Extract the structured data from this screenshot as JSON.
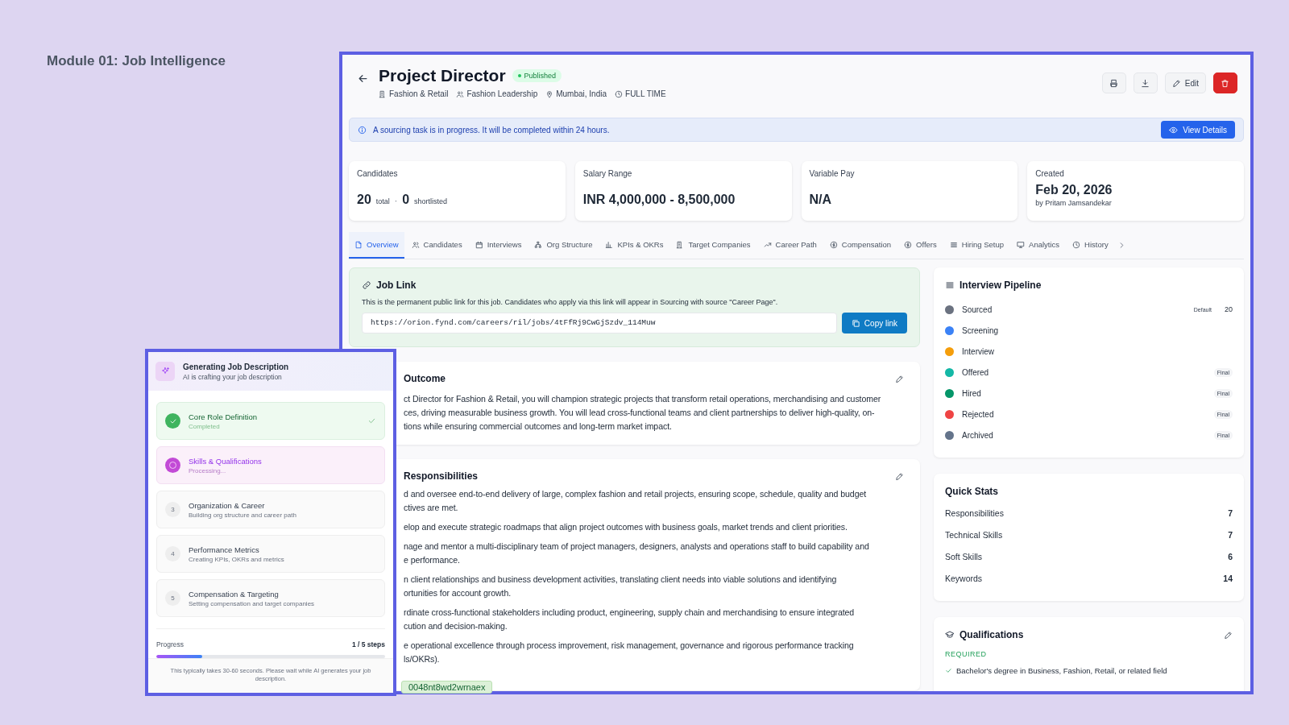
{
  "page_title": "Module 01: Job Intelligence",
  "job": {
    "title": "Project Director",
    "status": "Published",
    "meta": [
      "Fashion & Retail",
      "Fashion Leadership",
      "Mumbai, India",
      "FULL TIME"
    ],
    "edit_button": "Edit"
  },
  "banner": {
    "message": "A sourcing task is in progress. It will be completed within 24 hours.",
    "button": "View Details"
  },
  "stats": [
    {
      "label": "Candidates",
      "kind": "candidates",
      "total": "20",
      "total_label": "total",
      "separator": "·",
      "shortlisted": "0",
      "shortlisted_label": "shortlisted"
    },
    {
      "label": "Salary Range",
      "kind": "value",
      "value": "INR 4,000,000 - 8,500,000"
    },
    {
      "label": "Variable Pay",
      "kind": "value",
      "value": "N/A"
    },
    {
      "label": "Created",
      "kind": "date",
      "value": "Feb 20, 2026",
      "sub": "by Pritam Jamsandekar"
    }
  ],
  "tabs": [
    {
      "label": "Overview",
      "selected": true
    },
    {
      "label": "Candidates",
      "selected": false
    },
    {
      "label": "Interviews",
      "selected": false
    },
    {
      "label": "Org Structure",
      "selected": false
    },
    {
      "label": "KPIs & OKRs",
      "selected": false
    },
    {
      "label": "Target Companies",
      "selected": false
    },
    {
      "label": "Career Path",
      "selected": false
    },
    {
      "label": "Compensation",
      "selected": false
    },
    {
      "label": "Offers",
      "selected": false
    },
    {
      "label": "Hiring Setup",
      "selected": false
    },
    {
      "label": "Analytics",
      "selected": false
    },
    {
      "label": "History",
      "selected": false
    }
  ],
  "job_link": {
    "title": "Job Link",
    "description": "This is the permanent public link for this job. Candidates who apply via this link will appear in Sourcing with source \"Career Page\".",
    "url": "https://orion.fynd.com/careers/ril/jobs/4tFfRj9CwGjSzdv_114Muw",
    "button": "Copy link"
  },
  "outcome": {
    "title": "Outcome",
    "lines": [
      "ct Director for Fashion & Retail, you will champion strategic projects that transform retail operations, merchandising and customer",
      "ces, driving measurable business growth. You will lead cross-functional teams and client partnerships to deliver high-quality, on-",
      "tions while ensuring commercial outcomes and long-term market impact."
    ]
  },
  "responsibilities": {
    "title": "Responsibilities",
    "items": [
      {
        "lines": [
          "d and oversee end-to-end delivery of large, complex fashion and retail projects, ensuring scope, schedule, quality and budget",
          "ctives are met."
        ]
      },
      {
        "lines": [
          "elop and execute strategic roadmaps that align project outcomes with business goals, market trends and client priorities."
        ]
      },
      {
        "lines": [
          "nage and mentor a multi-disciplinary team of project managers, designers, analysts and operations staff to build capability and",
          "e performance."
        ]
      },
      {
        "lines": [
          "n client relationships and business development activities, translating client needs into viable solutions and identifying",
          "ortunities for account growth."
        ]
      },
      {
        "lines": [
          "rdinate cross-functional stakeholders including product, engineering, supply chain and merchandising to ensure integrated",
          "cution and decision-making."
        ]
      },
      {
        "lines": [
          "e operational excellence through process improvement, risk management, governance and rigorous performance tracking",
          "ls/OKRs)."
        ]
      }
    ]
  },
  "pipeline": {
    "title": "Interview Pipeline",
    "stages": [
      {
        "name": "Sourced",
        "color": "#6b7280",
        "note": "Default",
        "count": "20"
      },
      {
        "name": "Screening",
        "color": "#3b82f6"
      },
      {
        "name": "Interview",
        "color": "#f59e0b"
      },
      {
        "name": "Offered",
        "color": "#14b8a6",
        "badge": "Final"
      },
      {
        "name": "Hired",
        "color": "#059669",
        "badge": "Final"
      },
      {
        "name": "Rejected",
        "color": "#ef4444",
        "badge": "Final"
      },
      {
        "name": "Archived",
        "color": "#64748b",
        "badge": "Final"
      }
    ]
  },
  "quick_stats": {
    "title": "Quick Stats",
    "rows": [
      {
        "label": "Responsibilities",
        "value": "7"
      },
      {
        "label": "Technical Skills",
        "value": "7"
      },
      {
        "label": "Soft Skills",
        "value": "6"
      },
      {
        "label": "Keywords",
        "value": "14"
      }
    ]
  },
  "qualifications": {
    "title": "Qualifications",
    "section": "REQUIRED",
    "items": [
      "Bachelor's degree in Business, Fashion, Retail, or related field"
    ]
  },
  "generator": {
    "title": "Generating Job Description",
    "subtitle": "AI is crafting your job description",
    "steps": [
      {
        "kind": "completed",
        "title": "Core Role Definition",
        "status_text": "Completed"
      },
      {
        "kind": "processing",
        "title": "Skills & Qualifications",
        "status_text": "Processing..."
      },
      {
        "kind": "pending",
        "number": "3",
        "title": "Organization & Career",
        "status_text": "Building org structure and career path"
      },
      {
        "kind": "pending",
        "number": "4",
        "title": "Performance Metrics",
        "status_text": "Creating KPIs, OKRs and metrics"
      },
      {
        "kind": "pending",
        "number": "5",
        "title": "Compensation & Targeting",
        "status_text": "Setting compensation and target companies"
      }
    ],
    "progress_label": "Progress",
    "progress_count": "1 / 5 steps",
    "level": 0.2,
    "note": "This typically takes 30-60 seconds. Please wait while AI generates your job description."
  },
  "tag_chip": "0048nt8wd2wrnaex"
}
